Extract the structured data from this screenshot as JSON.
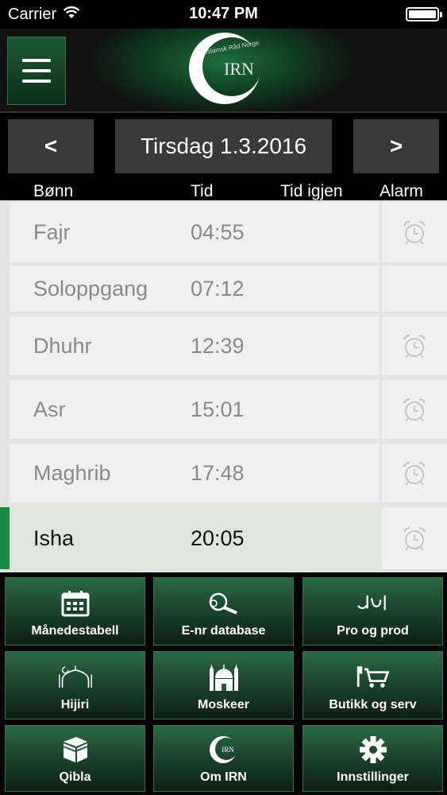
{
  "status_bar": {
    "carrier": "Carrier",
    "time": "10:47 PM"
  },
  "header": {
    "logo_text": "IRN",
    "logo_subtext": "Islamsk Råd Norge"
  },
  "date_nav": {
    "prev": "<",
    "date": "Tirsdag 1.3.2016",
    "next": ">"
  },
  "columns": {
    "prayer": "Bønn",
    "time": "Tid",
    "remaining": "Tid igjen",
    "alarm": "Alarm"
  },
  "prayers": [
    {
      "name": "Fajr",
      "time": "04:55",
      "alarm": true,
      "active": false
    },
    {
      "name": "Soloppgang",
      "time": "07:12",
      "alarm": false,
      "active": false
    },
    {
      "name": "Dhuhr",
      "time": "12:39",
      "alarm": true,
      "active": false
    },
    {
      "name": "Asr",
      "time": "15:01",
      "alarm": true,
      "active": false
    },
    {
      "name": "Maghrib",
      "time": "17:48",
      "alarm": true,
      "active": false
    },
    {
      "name": "Isha",
      "time": "20:05",
      "alarm": true,
      "active": true
    }
  ],
  "menu": [
    {
      "label": "Månedestabell",
      "icon": "calendar-icon"
    },
    {
      "label": "E-nr database",
      "icon": "magnifier-icon"
    },
    {
      "label": "Pro og prod",
      "icon": "halal-icon"
    },
    {
      "label": "Hijiri",
      "icon": "mosque-dome-icon"
    },
    {
      "label": "Moskeer",
      "icon": "mosque-icon"
    },
    {
      "label": "Butikk og serv",
      "icon": "cart-icon"
    },
    {
      "label": "Qibla",
      "icon": "kaaba-icon"
    },
    {
      "label": "Om IRN",
      "icon": "irn-logo-icon"
    },
    {
      "label": "Innstillinger",
      "icon": "gear-icon"
    }
  ],
  "colors": {
    "accent_green": "#1e8a3c",
    "header_green": "#1f6e3a",
    "button_gray": "#3a3a3a"
  }
}
